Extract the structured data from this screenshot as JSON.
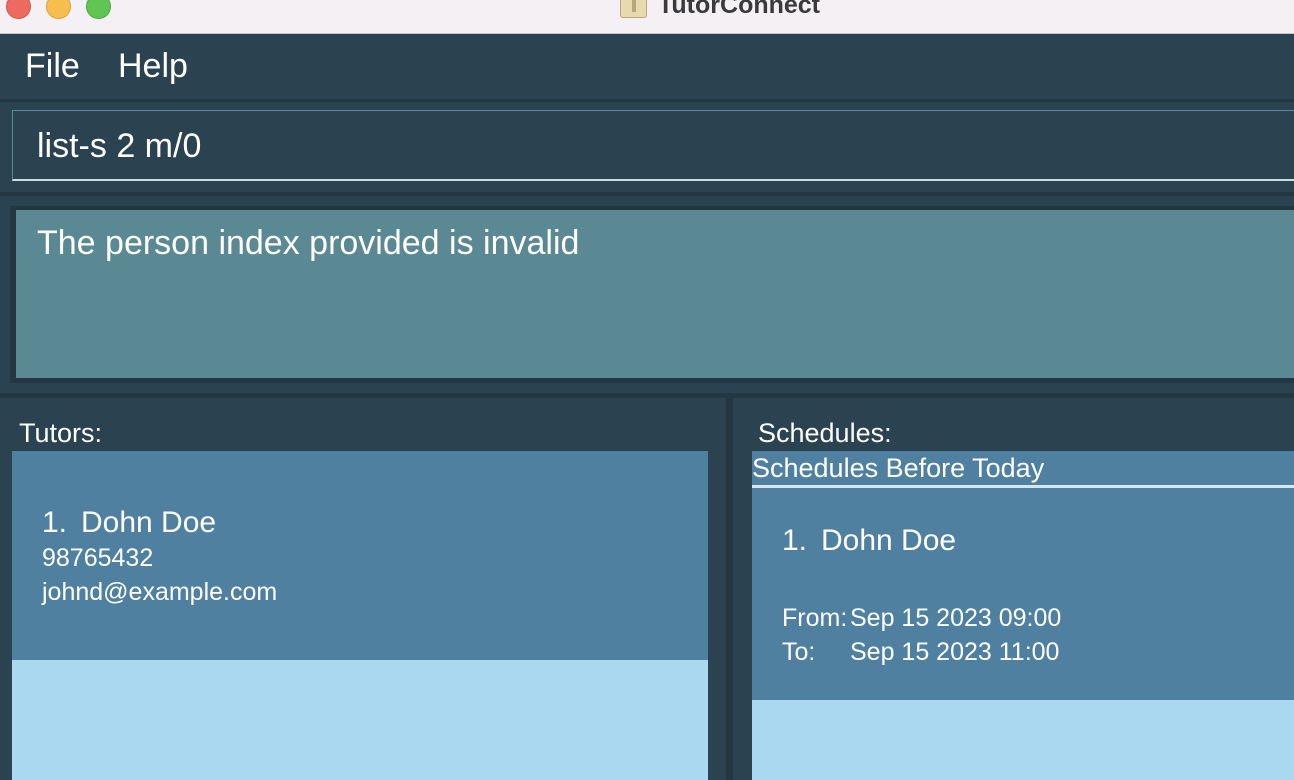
{
  "window": {
    "title": "TutorConnect"
  },
  "menu": {
    "file": "File",
    "help": "Help"
  },
  "command": {
    "value": "list-s 2 m/0"
  },
  "result": {
    "message": "The person index provided is invalid"
  },
  "tutors": {
    "label": "Tutors:",
    "items": [
      {
        "index": "1.",
        "name": "Dohn Doe",
        "phone": "98765432",
        "email": "johnd@example.com"
      }
    ]
  },
  "schedules": {
    "label": "Schedules:",
    "section_header": "Schedules Before Today",
    "items": [
      {
        "index": "1.",
        "name": "Dohn Doe",
        "from_label": "From:",
        "from": "Sep 15 2023 09:00",
        "to_label": "To:",
        "to": "Sep 15 2023 11:00"
      }
    ]
  },
  "colors": {
    "background": "#2b4250",
    "card": "#4f80a0",
    "list_empty": "#a9d8f0",
    "result_box": "#5a8893"
  }
}
